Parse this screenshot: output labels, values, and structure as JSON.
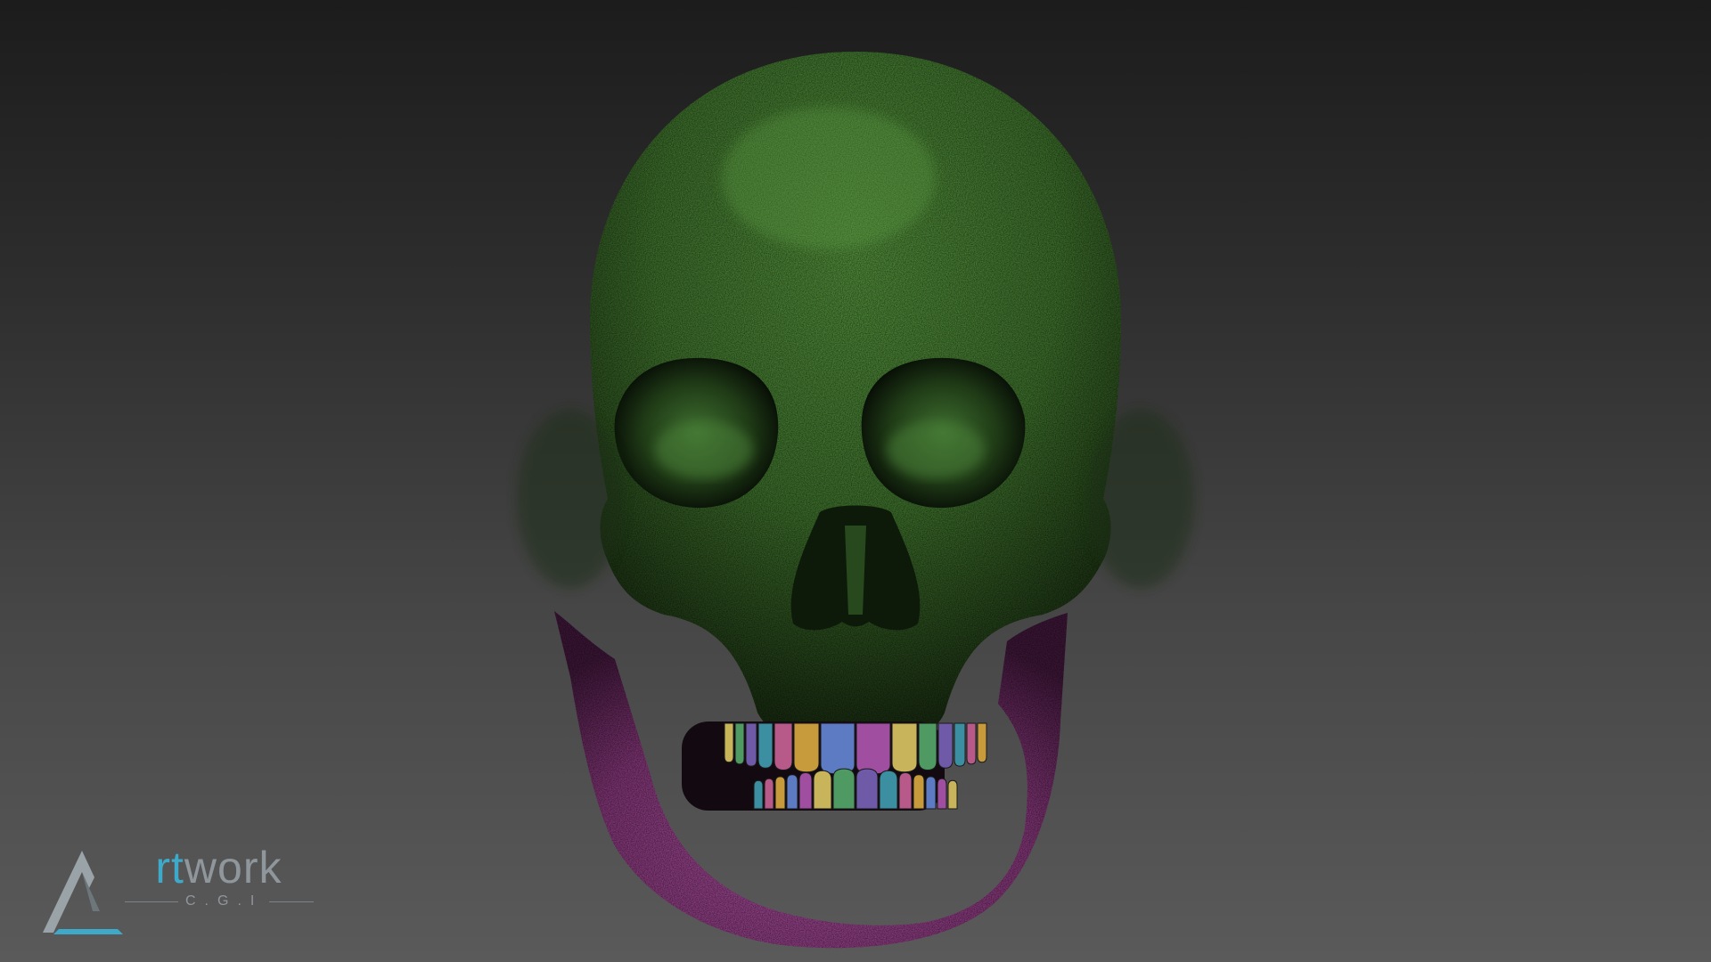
{
  "viewport": {
    "model": "skull",
    "background": [
      "#1c1c1c",
      "#5a5a5a"
    ],
    "colors": {
      "cranium": "#3b6b2a",
      "mandible": "#8a3b80",
      "teeth": [
        "#c8b45a",
        "#4f9a63",
        "#6f5aa8",
        "#3c8fa0",
        "#b75a8a",
        "#c79a3b",
        "#5c7bc2",
        "#a04fa0"
      ]
    }
  },
  "logo": {
    "word_start": "A",
    "word_accent": "rt",
    "word_rest": "work",
    "sub": "C.G.I",
    "colors": {
      "accent": "#3fa9c9",
      "gray": "#8f979c"
    }
  }
}
